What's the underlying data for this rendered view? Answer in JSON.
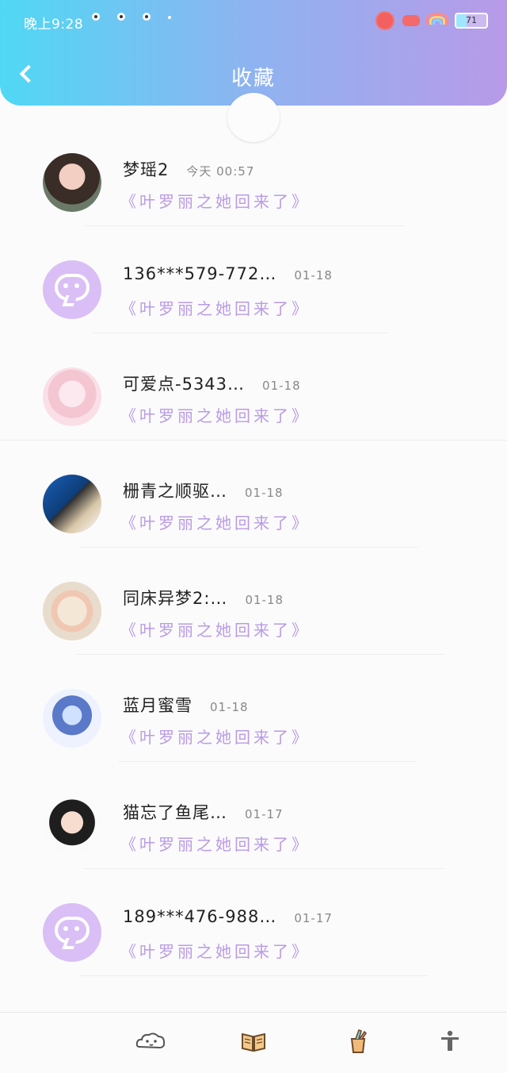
{
  "status_bar": {
    "time": "晚上9:28",
    "battery": "71"
  },
  "header": {
    "title": "收藏"
  },
  "items": [
    {
      "name": "梦瑶2",
      "date": "今天 00:57",
      "subtitle": "《叶罗丽之她回来了》"
    },
    {
      "name": "136***579-772…",
      "date": "01-18",
      "subtitle": "《叶罗丽之她回来了》"
    },
    {
      "name": "可爱点-5343…",
      "date": "01-18",
      "subtitle": "《叶罗丽之她回来了》"
    },
    {
      "name": "栅青之顺驱…",
      "date": "01-18",
      "subtitle": "《叶罗丽之她回来了》"
    },
    {
      "name": "同床异梦2:…",
      "date": "01-18",
      "subtitle": "《叶罗丽之她回来了》"
    },
    {
      "name": "蓝月蜜雪",
      "date": "01-18",
      "subtitle": "《叶罗丽之她回来了》"
    },
    {
      "name": "猫忘了鱼尾…",
      "date": "01-17",
      "subtitle": "《叶罗丽之她回来了》"
    },
    {
      "name": "189***476-988…",
      "date": "01-17",
      "subtitle": "《叶罗丽之她回来了》"
    }
  ],
  "tabbar": {
    "icons": [
      "cloud-pet-icon",
      "book-icon",
      "pencil-cup-icon",
      "accessibility-icon"
    ]
  },
  "colors": {
    "accent": "#b99be6",
    "header_start": "#4fd8f4",
    "header_end": "#b89ae8"
  }
}
